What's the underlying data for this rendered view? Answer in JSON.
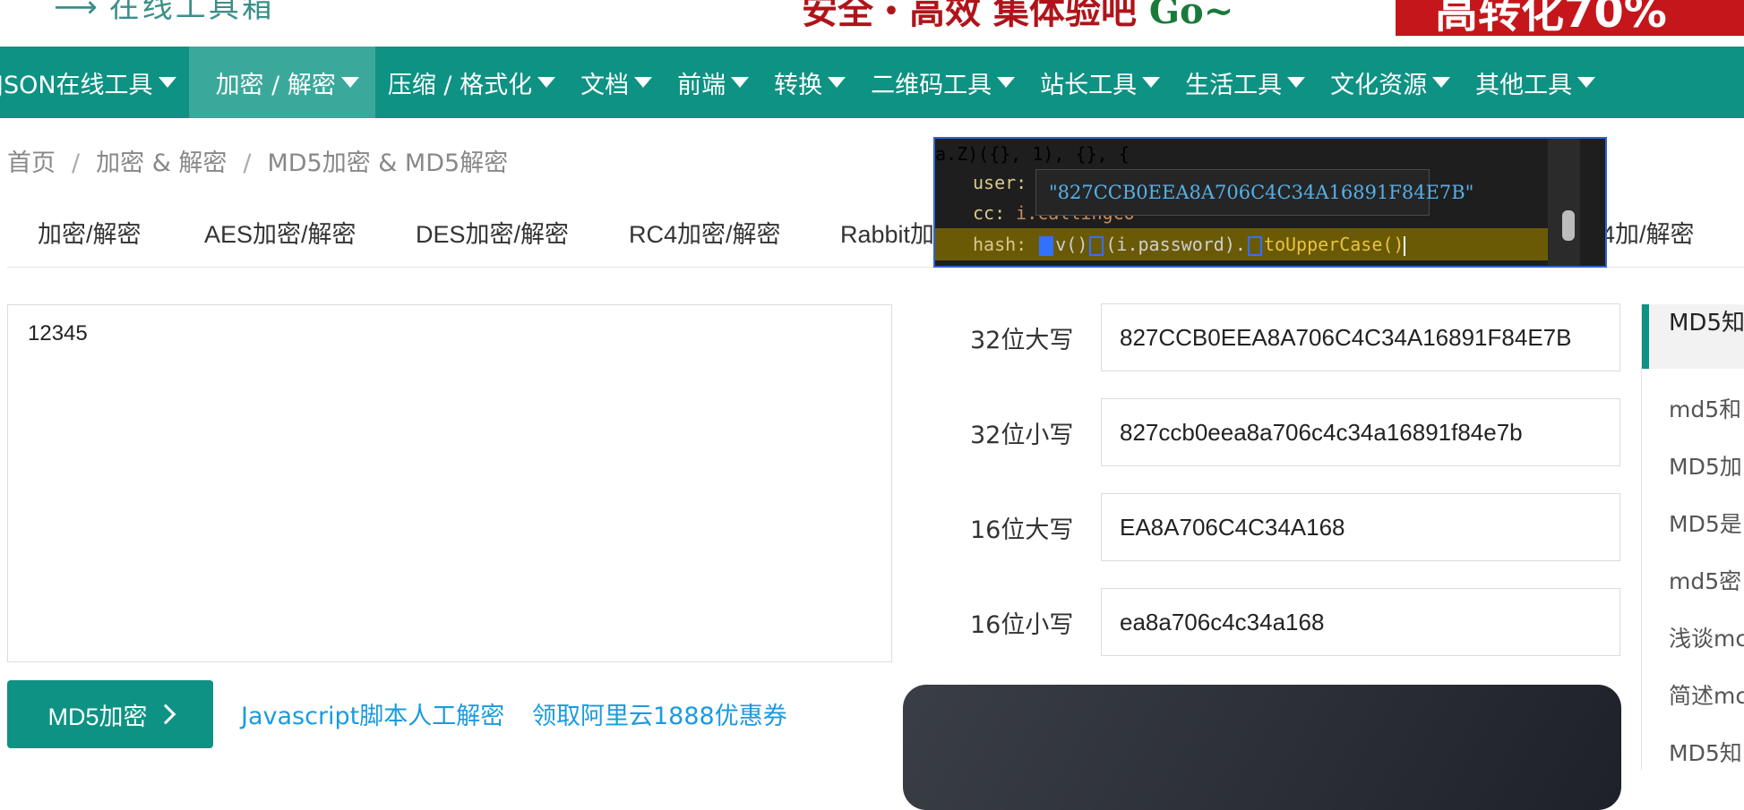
{
  "header": {
    "logo_text": "在线工具箱",
    "slogan_main": "安全・高效 集体验吧",
    "slogan_go": "Go~",
    "ad_text": "高转化70%"
  },
  "nav": {
    "items": [
      {
        "label": "JSON在线工具"
      },
      {
        "label": "加密 / 解密",
        "active": true
      },
      {
        "label": "压缩 / 格式化"
      },
      {
        "label": "文档"
      },
      {
        "label": "前端"
      },
      {
        "label": "转换"
      },
      {
        "label": "二维码工具"
      },
      {
        "label": "站长工具"
      },
      {
        "label": "生活工具"
      },
      {
        "label": "文化资源"
      },
      {
        "label": "其他工具"
      }
    ]
  },
  "breadcrumb": {
    "home": "首页",
    "sep": "/",
    "section": "加密 & 解密",
    "current": "MD5加密 & MD5解密"
  },
  "subtabs": [
    "加密/解密",
    "AES加密/解密",
    "DES加密/解密",
    "RC4加密/解密",
    "Rabbit加",
    "4加/解密"
  ],
  "input": {
    "value": "12345"
  },
  "results": {
    "upper32_label": "32位大写",
    "upper32_value": "827CCB0EEA8A706C4C34A16891F84E7B",
    "lower32_label": "32位小写",
    "lower32_value": "827ccb0eea8a706c4c34a16891f84e7b",
    "upper16_label": "16位大写",
    "upper16_value": "EA8A706C4C34A168",
    "lower16_label": "16位小写",
    "lower16_value": "ea8a706c4c34a168"
  },
  "actions": {
    "encrypt_button": "MD5加密",
    "js_decrypt_link": "Javascript脚本人工解密",
    "aliyun_link": "领取阿里云1888优惠券"
  },
  "sidebar": {
    "heading": "MD5知",
    "items": [
      "md5和",
      "MD5加",
      "MD5是",
      "md5密",
      "浅谈mc",
      "简述mc",
      "MD5知"
    ]
  },
  "devtools": {
    "line1": "a.Z)({}, 1), {}, {",
    "user_key": "user:",
    "cc_key": "cc:",
    "cc_value": " i.callingCo",
    "hash_key": "hash:",
    "hash_v": "v()",
    "hash_arg": "(i.password).",
    "hash_method": "toUpperCase()",
    "tooltip_value": "\"827CCB0EEA8A706C4C34A16891F84E7B\""
  },
  "colors": {
    "brand": "#0e9283",
    "link": "#1a9be0",
    "ad_red": "#c5161b"
  }
}
